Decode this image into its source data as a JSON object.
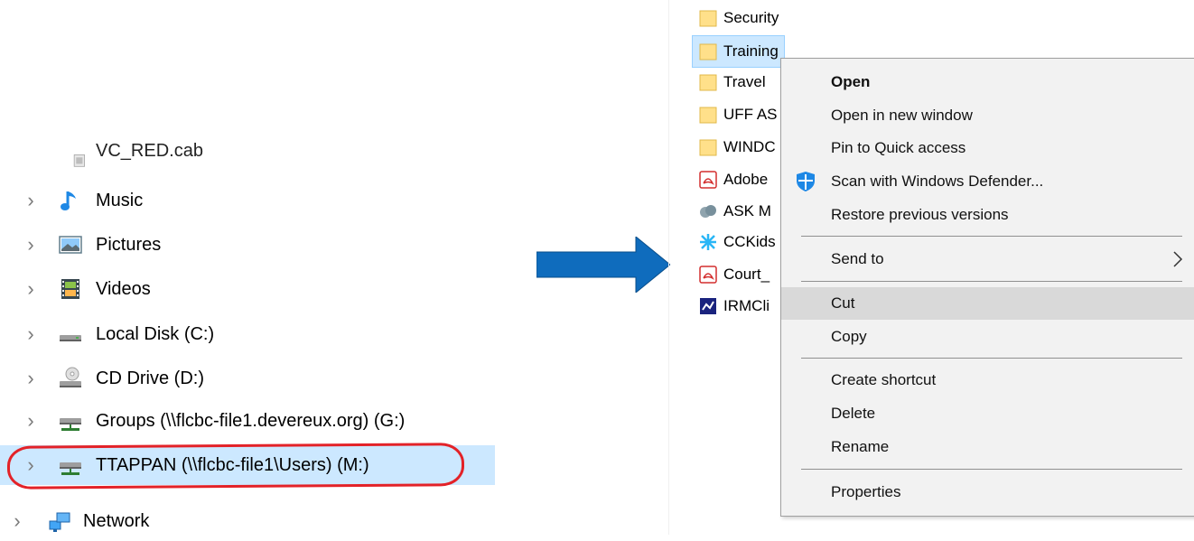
{
  "left_pane": {
    "partial_item": "VC_RED.cab",
    "items": [
      {
        "label": "Music",
        "icon": "music-icon"
      },
      {
        "label": "Pictures",
        "icon": "pictures-icon"
      },
      {
        "label": "Videos",
        "icon": "videos-icon"
      },
      {
        "label": "Local Disk (C:)",
        "icon": "local-disk-icon"
      },
      {
        "label": "CD Drive (D:)",
        "icon": "cd-drive-icon"
      },
      {
        "label": "Groups (\\\\flcbc-file1.devereux.org) (G:)",
        "icon": "network-drive-icon"
      },
      {
        "label": "TTAPPAN (\\\\flcbc-file1\\Users) (M:)",
        "icon": "network-drive-icon",
        "selected": true
      },
      {
        "label": "Network",
        "icon": "network-icon"
      }
    ],
    "highlight_color": "#e32228",
    "selection_color": "#cce8ff"
  },
  "arrow_color": "#0f6cbd",
  "right_pane": {
    "files": [
      {
        "label": "Security",
        "icon": "folder-icon"
      },
      {
        "label": "Training",
        "icon": "folder-icon",
        "selected": true
      },
      {
        "label": "Travel",
        "icon": "folder-icon"
      },
      {
        "label": "UFF AS",
        "icon": "folder-icon"
      },
      {
        "label": "WINDC",
        "icon": "folder-icon"
      },
      {
        "label": "Adobe",
        "icon": "pdf-icon"
      },
      {
        "label": "ASK M",
        "icon": "app-icon"
      },
      {
        "label": "CCKids",
        "icon": "app-icon"
      },
      {
        "label": "Court_",
        "icon": "pdf-icon"
      },
      {
        "label": "IRMCli",
        "icon": "app-icon"
      }
    ]
  },
  "context_menu": {
    "items": [
      {
        "label": "Open",
        "bold": true
      },
      {
        "label": "Open in new window"
      },
      {
        "label": "Pin to Quick access"
      },
      {
        "label": "Scan with Windows Defender...",
        "icon": "windows-defender-icon"
      },
      {
        "label": "Restore previous versions"
      },
      {
        "label": "Send to",
        "submenu": true
      },
      {
        "label": "Cut",
        "hover": true
      },
      {
        "label": "Copy"
      },
      {
        "label": "Create shortcut"
      },
      {
        "label": "Delete"
      },
      {
        "label": "Rename"
      },
      {
        "label": "Properties"
      }
    ],
    "hover_color": "#d9d9d9"
  }
}
